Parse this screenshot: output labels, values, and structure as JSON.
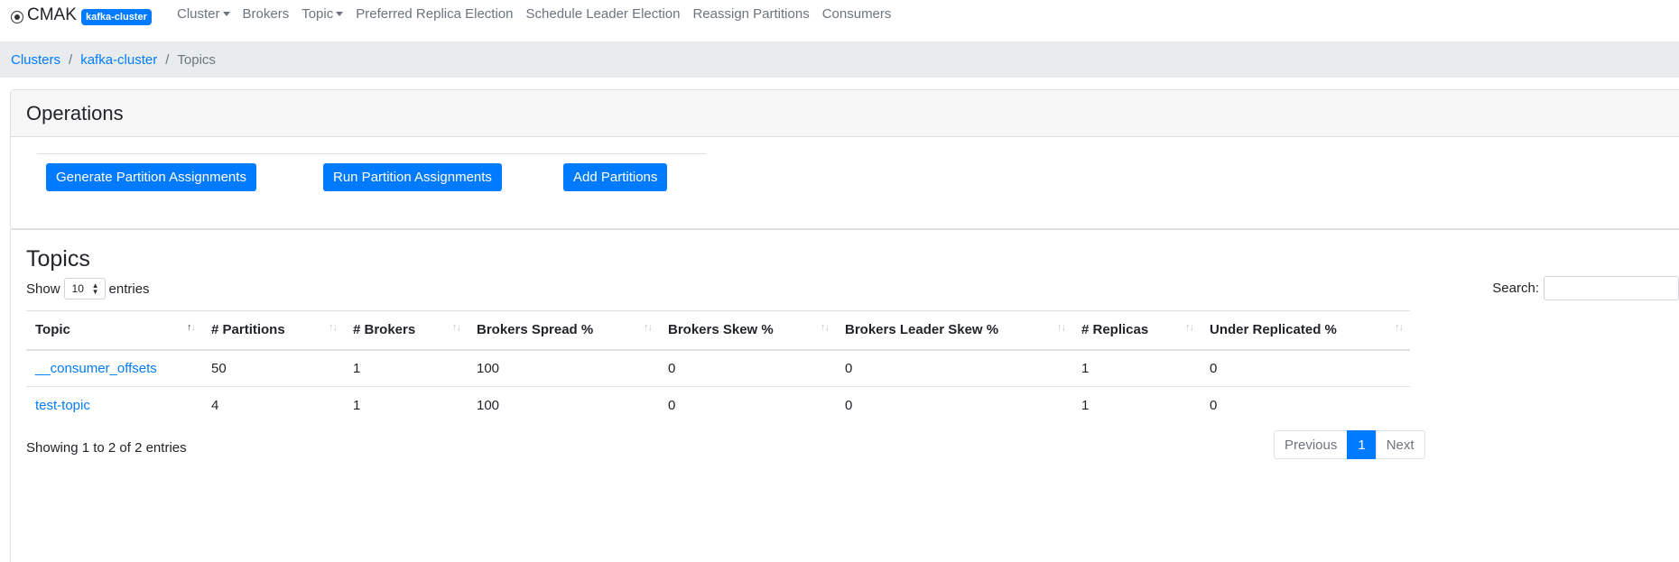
{
  "navbar": {
    "brand": "CMAK",
    "cluster_badge": "kafka-cluster",
    "links": {
      "cluster": "Cluster",
      "brokers": "Brokers",
      "topic": "Topic",
      "preferred_replica_election": "Preferred Replica Election",
      "schedule_leader_election": "Schedule Leader Election",
      "reassign_partitions": "Reassign Partitions",
      "consumers": "Consumers"
    }
  },
  "breadcrumb": {
    "items": [
      "Clusters",
      "kafka-cluster",
      "Topics"
    ],
    "separator": "/"
  },
  "operations": {
    "title": "Operations",
    "buttons": {
      "generate": "Generate Partition Assignments",
      "run": "Run Partition Assignments",
      "add": "Add Partitions"
    }
  },
  "topics": {
    "title": "Topics",
    "show_label": "Show",
    "entries_label": "entries",
    "page_length": "10",
    "search_label": "Search:",
    "search_value": "",
    "columns": [
      "Topic",
      "# Partitions",
      "# Brokers",
      "Brokers Spread %",
      "Brokers Skew %",
      "Brokers Leader Skew %",
      "# Replicas",
      "Under Replicated %"
    ],
    "rows": [
      [
        "__consumer_offsets",
        "50",
        "1",
        "100",
        "0",
        "0",
        "1",
        "0"
      ],
      [
        "test-topic",
        "4",
        "1",
        "100",
        "0",
        "0",
        "1",
        "0"
      ]
    ],
    "info": "Showing 1 to 2 of 2 entries",
    "pagination": {
      "previous": "Previous",
      "page": "1",
      "next": "Next"
    }
  },
  "colors": {
    "primary": "#007bff",
    "breadcrumb_bg": "#e9ecef",
    "muted": "#6c757d"
  }
}
